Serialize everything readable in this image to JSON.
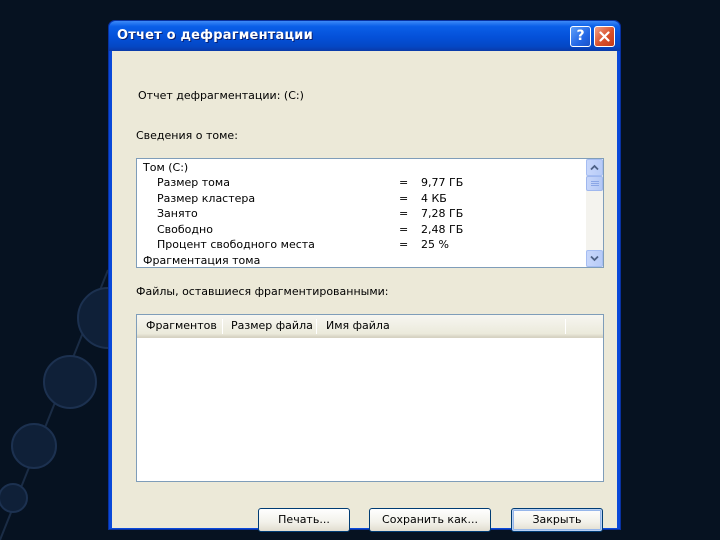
{
  "window": {
    "title": "Отчет о дефрагментации",
    "help_glyph": "?"
  },
  "report": {
    "heading": "Отчет дефрагментации:  (C:)",
    "volume_info_label": "Сведения о томе:"
  },
  "volume_info": {
    "lines": [
      {
        "label": "Том (C:)",
        "eq": "",
        "value": ""
      },
      {
        "label": "Размер тома",
        "eq": "=",
        "value": "9,77 ГБ"
      },
      {
        "label": "Размер кластера",
        "eq": "=",
        "value": "4 КБ"
      },
      {
        "label": "Занято",
        "eq": "=",
        "value": "7,28 ГБ"
      },
      {
        "label": "Свободно",
        "eq": "=",
        "value": "2,48 ГБ"
      },
      {
        "label": "Процент свободного места",
        "eq": "=",
        "value": "25 %"
      },
      {
        "label": "Фрагментация тома",
        "eq": "",
        "value": ""
      }
    ]
  },
  "files": {
    "label": "Файлы, оставшиеся фрагментированными:",
    "columns": [
      "Фрагментов",
      "Размер файла",
      "Имя файла"
    ]
  },
  "buttons": {
    "print": "Печать...",
    "save_as": "Сохранить как...",
    "close": "Закрыть"
  }
}
